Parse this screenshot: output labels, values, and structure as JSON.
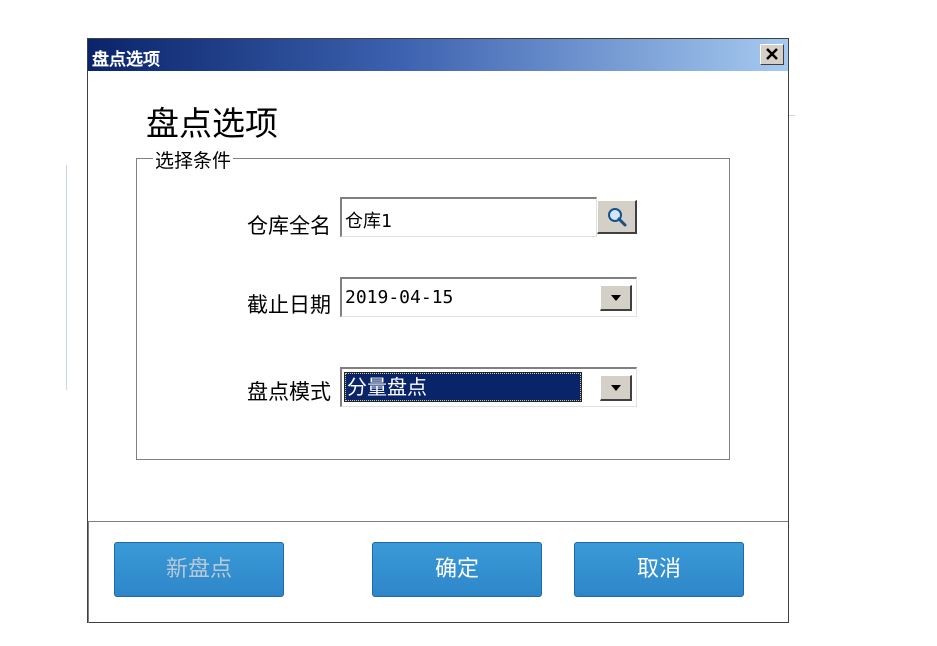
{
  "window": {
    "title": "盘点选项",
    "close_glyph": "×"
  },
  "heading": "盘点选项",
  "group": {
    "legend": "选择条件"
  },
  "fields": {
    "warehouse_label": "仓库全名",
    "warehouse_value": "仓库1",
    "date_label": "截止日期",
    "date_value": "2019-04-15",
    "mode_label": "盘点模式",
    "mode_value": "分量盘点"
  },
  "buttons": {
    "new_count": "新盘点",
    "confirm": "确定",
    "cancel": "取消"
  },
  "icons": {
    "search": "search-icon",
    "dropdown": "chevron-down-icon",
    "close": "close-icon"
  },
  "colors": {
    "title_gradient_start": "#0a246a",
    "title_gradient_end": "#a6caf0",
    "button_blue": "#2e86c8",
    "selection": "#0a246a"
  }
}
